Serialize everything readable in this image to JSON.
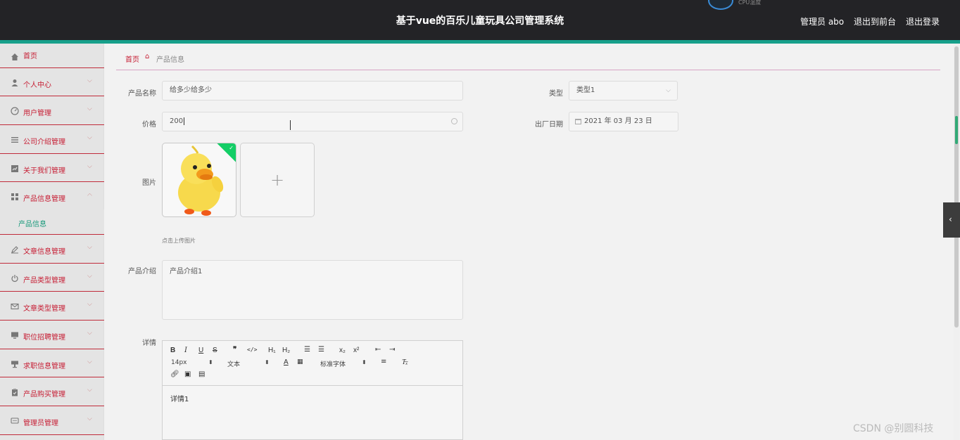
{
  "header": {
    "title": "基于vue的百乐儿童玩具公司管理系统",
    "cpu_label": "CPU温度",
    "admin_label": "管理员 abo",
    "back_frontend": "退出到前台",
    "logout": "退出登录"
  },
  "sidebar": {
    "items": [
      {
        "label": "首页",
        "icon": "home-icon"
      },
      {
        "label": "个人中心",
        "icon": "user-icon"
      },
      {
        "label": "用户管理",
        "icon": "dashboard-icon"
      },
      {
        "label": "公司介绍管理",
        "icon": "list-icon"
      },
      {
        "label": "关于我们管理",
        "icon": "chart-icon"
      },
      {
        "label": "产品信息管理",
        "icon": "grid-icon"
      },
      {
        "label": "文章信息管理",
        "icon": "pen-icon"
      },
      {
        "label": "产品类型管理",
        "icon": "power-icon"
      },
      {
        "label": "文章类型管理",
        "icon": "mail-icon"
      },
      {
        "label": "职位招聘管理",
        "icon": "monitor-icon"
      },
      {
        "label": "求职信息管理",
        "icon": "stand-icon"
      },
      {
        "label": "产品购买管理",
        "icon": "clipboard-icon"
      },
      {
        "label": "管理员管理",
        "icon": "message-icon"
      }
    ],
    "sub_item": "产品信息"
  },
  "breadcrumb": {
    "home": "首页",
    "current": "产品信息"
  },
  "form": {
    "name_label": "产品名称",
    "name_value": "给多少给多少",
    "type_label": "类型",
    "type_value": "类型1",
    "price_label": "价格",
    "price_value": "200",
    "date_label": "出厂日期",
    "date_value": "2021 年 03 月 23 日",
    "image_label": "图片",
    "upload_hint": "点击上传图片",
    "intro_label": "产品介绍",
    "intro_value": "产品介绍1",
    "detail_label": "详情",
    "detail_value": "详情1"
  },
  "editor": {
    "font_size": "14px",
    "format": "文本",
    "font_family": "标准字体"
  },
  "watermark": "CSDN @别圆科技"
}
